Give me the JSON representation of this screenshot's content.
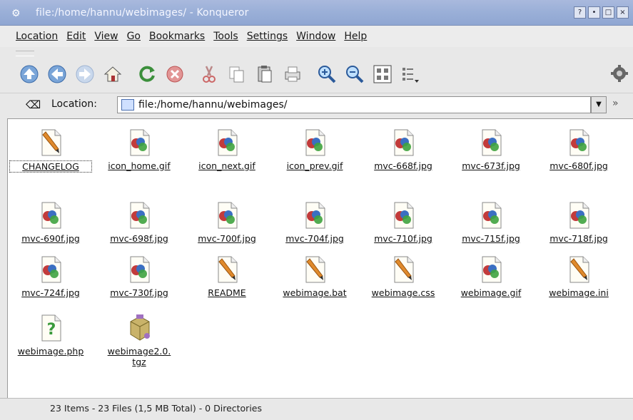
{
  "window": {
    "title": "file:/home/hannu/webimages/ - Konqueror",
    "controls": [
      "?",
      "•",
      "□",
      "×"
    ]
  },
  "menubar": [
    "Location",
    "Edit",
    "View",
    "Go",
    "Bookmarks",
    "Tools",
    "Settings",
    "Window",
    "Help"
  ],
  "toolbar": {
    "icons": [
      "up-arrow-icon",
      "back-arrow-icon",
      "forward-arrow-icon",
      "home-icon",
      "reload-icon",
      "stop-icon",
      "cut-icon",
      "copy-icon",
      "paste-icon",
      "print-icon",
      "zoom-in-icon",
      "zoom-out-icon",
      "icon-view-icon",
      "list-view-icon"
    ]
  },
  "location": {
    "label": "Location:",
    "value": "file:/home/hannu/webimages/",
    "more": "»"
  },
  "files": [
    {
      "name": "CHANGELOG",
      "type": "text"
    },
    {
      "name": "icon_home.gif",
      "type": "image"
    },
    {
      "name": "icon_next.gif",
      "type": "image"
    },
    {
      "name": "icon_prev.gif",
      "type": "image"
    },
    {
      "name": "mvc-668f.jpg",
      "type": "image"
    },
    {
      "name": "mvc-673f.jpg",
      "type": "image"
    },
    {
      "name": "mvc-680f.jpg",
      "type": "image"
    },
    {
      "name": "mvc-690f.jpg",
      "type": "image"
    },
    {
      "name": "mvc-698f.jpg",
      "type": "image"
    },
    {
      "name": "mvc-700f.jpg",
      "type": "image"
    },
    {
      "name": "mvc-704f.jpg",
      "type": "image"
    },
    {
      "name": "mvc-710f.jpg",
      "type": "image"
    },
    {
      "name": "mvc-715f.jpg",
      "type": "image"
    },
    {
      "name": "mvc-718f.jpg",
      "type": "image"
    },
    {
      "name": "mvc-724f.jpg",
      "type": "image"
    },
    {
      "name": "mvc-730f.jpg",
      "type": "image"
    },
    {
      "name": "README",
      "type": "text"
    },
    {
      "name": "webimage.bat",
      "type": "text"
    },
    {
      "name": "webimage.css",
      "type": "text"
    },
    {
      "name": "webimage.gif",
      "type": "image"
    },
    {
      "name": "webimage.ini",
      "type": "text"
    },
    {
      "name": "webimage.php",
      "type": "php"
    },
    {
      "name": "webimage2.0.tgz",
      "type": "archive"
    }
  ],
  "status": "23 Items - 23 Files (1,5 MB Total) - 0 Directories"
}
